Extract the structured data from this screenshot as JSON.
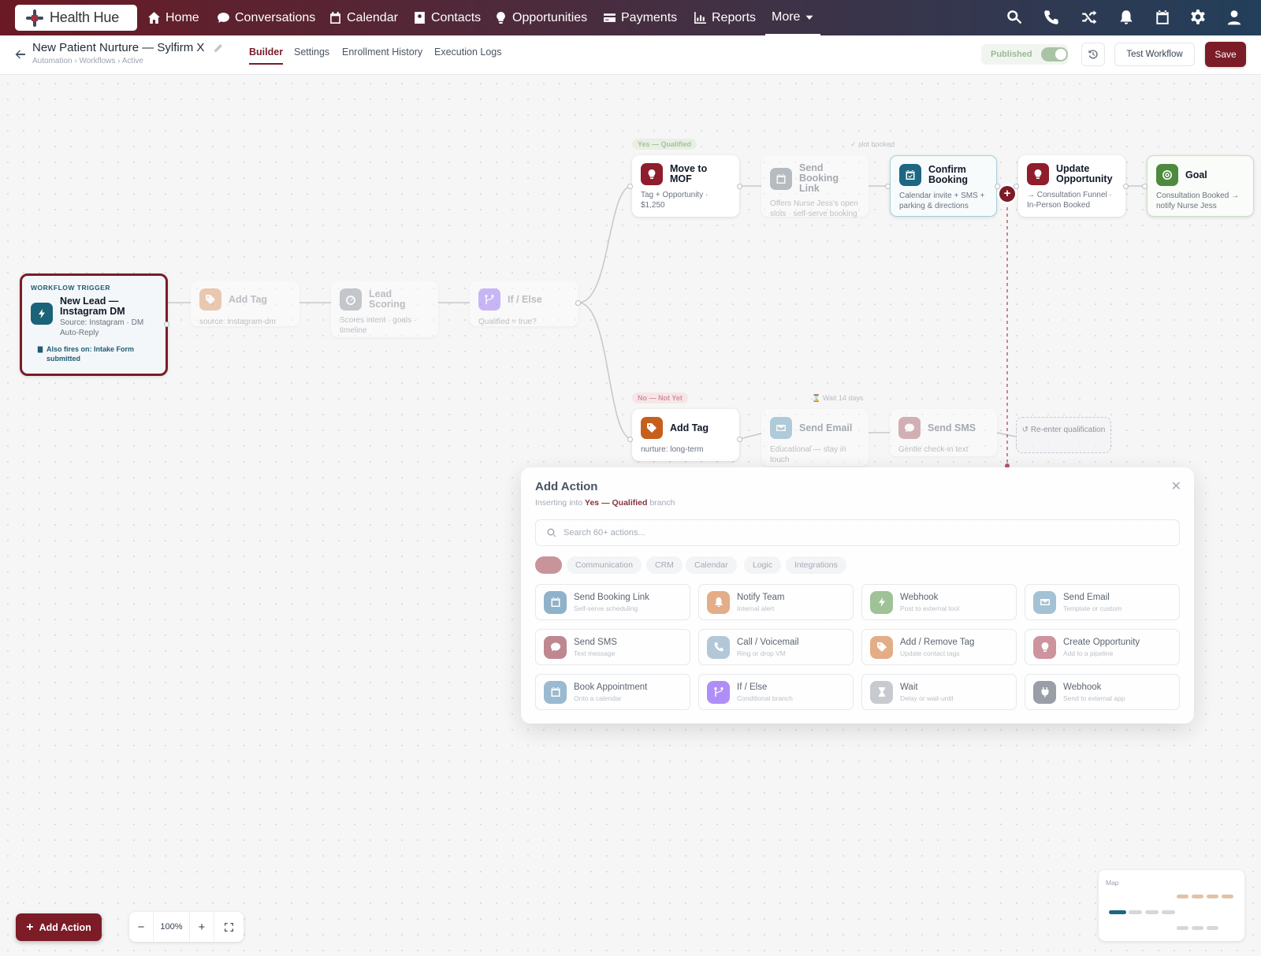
{
  "brand": {
    "name": "Health Hue"
  },
  "nav": {
    "items": [
      {
        "label": "Home",
        "icon": "home-icon"
      },
      {
        "label": "Conversations",
        "icon": "chat-icon"
      },
      {
        "label": "Calendar",
        "icon": "calendar-icon"
      },
      {
        "label": "Contacts",
        "icon": "contacts-icon"
      },
      {
        "label": "Opportunities",
        "icon": "lightbulb-icon"
      },
      {
        "label": "Payments",
        "icon": "card-icon"
      },
      {
        "label": "Reports",
        "icon": "chart-icon"
      },
      {
        "label": "More",
        "icon": "chevron-down-icon"
      }
    ],
    "right_icons": [
      "search-icon",
      "phone-icon",
      "shuffle-icon",
      "bell-icon",
      "calendar-icon",
      "gear-icon",
      "user-icon"
    ]
  },
  "workflow": {
    "title": "New Patient Nurture — Sylfirm X",
    "breadcrumb": "Automation › Workflows › Active",
    "tabs": [
      "Builder",
      "Settings",
      "Enrollment History",
      "Execution Logs"
    ],
    "active_tab": "Builder",
    "status": "Published",
    "published": true,
    "test_label": "Test Workflow",
    "save_label": "Save"
  },
  "colors": {
    "brand": "#7b1c27",
    "nav_start": "#6b1a24",
    "nav_end": "#233f5a"
  },
  "trigger": {
    "kicker": "WORKFLOW TRIGGER",
    "title": "New Lead — Instagram DM",
    "sub": "Source: Instagram · DM Auto-Reply",
    "also": "Also fires on: Intake Form submitted"
  },
  "nodes": {
    "add_tag": {
      "title": "Add Tag",
      "sub": "source: instagram-dm"
    },
    "lead_scoring": {
      "title": "Lead Scoring",
      "sub": "Scores intent · goals · timeline"
    },
    "if_else": {
      "title": "If / Else",
      "sub": "Qualified = true?"
    },
    "move_mof": {
      "title": "Move to MOF",
      "sub": "Tag + Opportunity · $1,250"
    },
    "send_booking": {
      "title": "Send Booking Link",
      "sub": "Offers Nurse Jess's open slots · self-serve booking"
    },
    "confirm_booking": {
      "title": "Confirm Booking",
      "sub": "Calendar invite + SMS + parking & directions"
    },
    "update_opp": {
      "title": "Update Opportunity",
      "sub": "→ Consultation Funnel · In-Person Booked"
    },
    "goal": {
      "title": "Goal",
      "sub": "Consultation Booked → notify Nurse Jess"
    },
    "add_tag_no": {
      "title": "Add Tag",
      "sub": "nurture: long-term"
    },
    "send_email": {
      "title": "Send Email",
      "sub": "Educational — stay in touch"
    },
    "send_sms": {
      "title": "Send SMS",
      "sub": "Gentle check-in text"
    }
  },
  "labels": {
    "yes": "Yes — Qualified",
    "no": "No — Not Yet",
    "slot_booked": "✓ slot booked",
    "wait": "⌛ Wait 14 days",
    "reenter": "↺ Re-enter qualification"
  },
  "modal": {
    "title": "Add Action",
    "sub_pre": "Inserting into",
    "sub_branch": "Yes — Qualified",
    "sub_post": "branch",
    "search_placeholder": "Search 60+ actions...",
    "chips": [
      "",
      "Communication",
      "CRM",
      "Calendar",
      "Logic",
      "Integrations"
    ],
    "actions": [
      {
        "title": "Send Booking Link",
        "sub": "Self-serve scheduling",
        "color": "#5b8fb3"
      },
      {
        "title": "Notify Team",
        "sub": "Internal alert",
        "color": "#d9894f"
      },
      {
        "title": "Webhook",
        "sub": "Post to external tool",
        "color": "#74a966"
      },
      {
        "title": "Send Email",
        "sub": "Template or custom",
        "color": "#7aa8c2"
      },
      {
        "title": "Send SMS",
        "sub": "Text message",
        "color": "#a34f5c"
      },
      {
        "title": "Call / Voicemail",
        "sub": "Ring or drop VM",
        "color": "#8fb1c8"
      },
      {
        "title": "Add / Remove Tag",
        "sub": "Update contact tags",
        "color": "#d9894f"
      },
      {
        "title": "Create Opportunity",
        "sub": "Add to a pipeline",
        "color": "#b86372"
      },
      {
        "title": "Book Appointment",
        "sub": "Onto a calendar",
        "color": "#6d9bbd"
      },
      {
        "title": "If / Else",
        "sub": "Conditional branch",
        "color": "#8b5cf6"
      },
      {
        "title": "Wait",
        "sub": "Delay or wait-until",
        "color": "#b0b5bc"
      },
      {
        "title": "Webhook",
        "sub": "Send to external app",
        "color": "#6b7280"
      }
    ]
  },
  "footer": {
    "add_action": "Add Action",
    "zoom": "100%",
    "map": "Map"
  }
}
